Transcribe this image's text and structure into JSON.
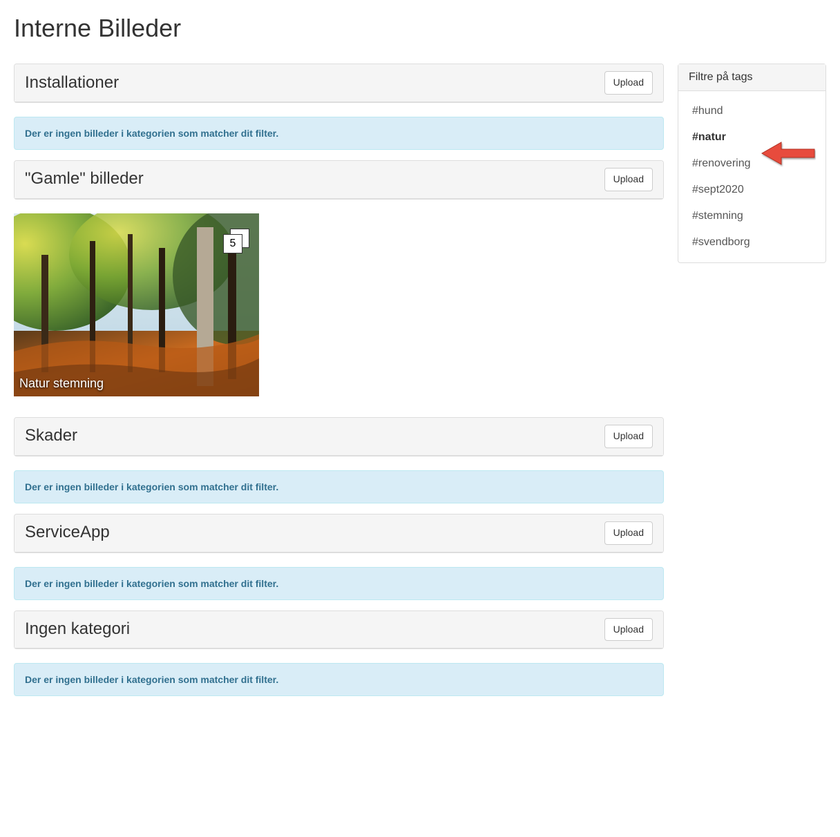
{
  "page_title": "Interne Billeder",
  "upload_label": "Upload",
  "empty_message": "Der er ingen billeder i kategorien som matcher dit filter.",
  "categories": [
    {
      "title": "Installationer",
      "has_images": false
    },
    {
      "title": "\"Gamle\" billeder",
      "has_images": true,
      "album": {
        "caption": "Natur stemning",
        "count": "5"
      }
    },
    {
      "title": "Skader",
      "has_images": false
    },
    {
      "title": "ServiceApp",
      "has_images": false
    },
    {
      "title": "Ingen kategori",
      "has_images": false
    }
  ],
  "filter": {
    "heading": "Filtre på tags",
    "tags": [
      {
        "label": "#hund",
        "active": false
      },
      {
        "label": "#natur",
        "active": true
      },
      {
        "label": "#renovering",
        "active": false
      },
      {
        "label": "#sept2020",
        "active": false
      },
      {
        "label": "#stemning",
        "active": false
      },
      {
        "label": "#svendborg",
        "active": false
      }
    ]
  },
  "annotation": {
    "arrow_color": "#e74c3c"
  }
}
